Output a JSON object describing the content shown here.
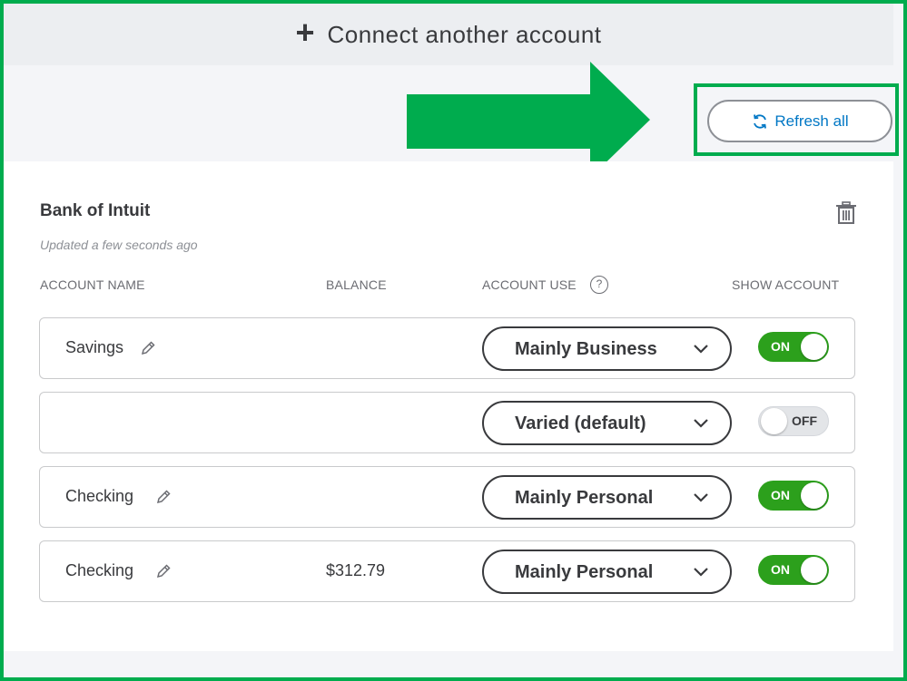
{
  "connect": {
    "plus": "+",
    "label": "Connect another account"
  },
  "refresh": {
    "label": "Refresh all",
    "icon": "refresh-icon",
    "color": "#0077c5"
  },
  "highlight_color": "#00ac4e",
  "bank": {
    "name": "Bank of Intuit",
    "updated": "Updated a few seconds ago"
  },
  "columns": {
    "account_name": "ACCOUNT NAME",
    "balance": "BALANCE",
    "account_use": "ACCOUNT USE",
    "help": "?",
    "show_account": "SHOW ACCOUNT"
  },
  "accounts": [
    {
      "name": "Savings",
      "balance": "",
      "use": "Mainly Business",
      "show": "ON"
    },
    {
      "name": "",
      "balance": "",
      "use": "Varied (default)",
      "show": "OFF"
    },
    {
      "name": "Checking",
      "balance": "",
      "use": "Mainly Personal",
      "show": "ON"
    },
    {
      "name": "Checking",
      "balance": "$312.79",
      "use": "Mainly Personal",
      "show": "ON"
    }
  ],
  "toggle_on_color": "#2ca01c"
}
